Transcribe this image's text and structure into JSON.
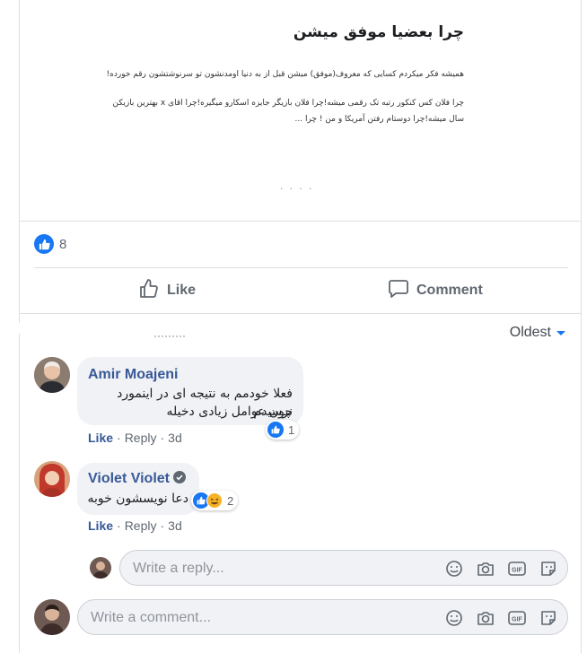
{
  "article": {
    "title": "چرا بعضیا موفق میشن",
    "paragraph1": "همیشه فکر میکردم کسایی که معروف(موفق) میشن قبل از به دنیا اومدنشون تو سرنوشتشون رقم خورده!",
    "paragraph2": "چرا فلان کس کنکور رتبه تک رقمی میشه!چرا فلان بازیگر جایزه اسکارو میگیره!چرا اقای x بهترین بازیکن سال میشه!چرا دوستام رفتن آمریکا و من ! چرا ...",
    "more": ". . . ."
  },
  "reactions": {
    "icon": "like-icon",
    "count": "8",
    "color": "#1877f2"
  },
  "actions": {
    "like_label": "Like",
    "comment_label": "Comment"
  },
  "sort": {
    "label": "Oldest"
  },
  "comments": [
    {
      "author": "Amir Moajeni",
      "line1": "فعلا خودمم به نتیجه ای در اینمورد نرسیدم",
      "line2": "چون عوامل زیادی دخیله",
      "reaction_count": "1",
      "like_label": "Like",
      "reply_label": "Reply",
      "time": "3d"
    },
    {
      "author": "Violet Violet",
      "line1": "دعا نویسشون خوبه",
      "reaction_count": "2",
      "like_label": "Like",
      "reply_label": "Reply",
      "time": "3d"
    }
  ],
  "reply_input": {
    "placeholder": "Write a reply..."
  },
  "comment_input": {
    "placeholder": "Write a comment..."
  },
  "tools": [
    "emoji-icon",
    "camera-icon",
    "gif-icon",
    "sticker-icon"
  ],
  "colors": {
    "link": "#385898",
    "accent": "#1877f2",
    "muted": "#606770",
    "bubble": "#f0f2f5"
  }
}
